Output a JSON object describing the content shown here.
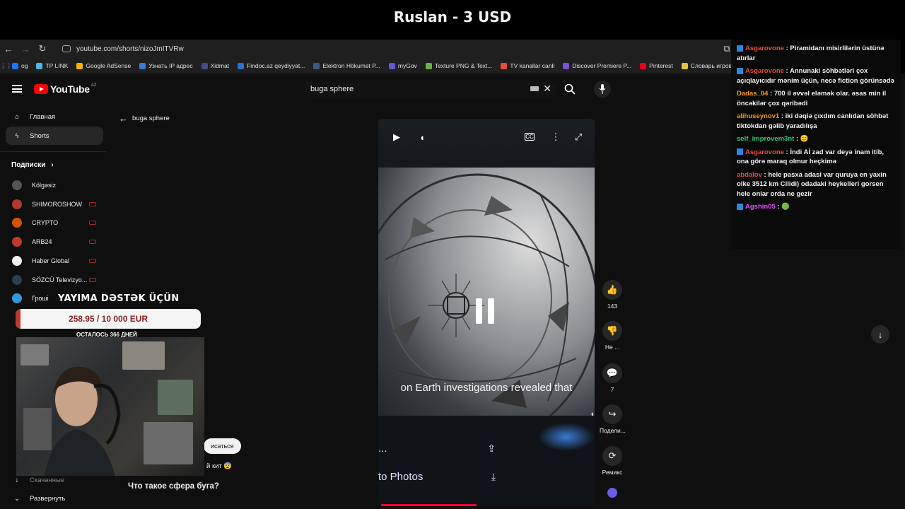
{
  "stream": {
    "title": "Ruslan - 3 USD"
  },
  "browser": {
    "url": "youtube.com/shorts/nizoJmITVRw",
    "bookmarks": [
      {
        "label": "og",
        "color": "#1877f2"
      },
      {
        "label": "TP LINK",
        "color": "#4ab8e8"
      },
      {
        "label": "Google AdSense",
        "color": "#f4b400"
      },
      {
        "label": "Узнать IP адрес",
        "color": "#3a7bd5"
      },
      {
        "label": "Xidmat",
        "color": "#444a8c"
      },
      {
        "label": "Findoc.az qeydiyyat...",
        "color": "#2a6fdb"
      },
      {
        "label": "Elektron Hökumət P...",
        "color": "#3d5a80"
      },
      {
        "label": "myGov",
        "color": "#5b5bd6"
      },
      {
        "label": "Texture PNG & Text...",
        "color": "#6ab04c"
      },
      {
        "label": "TV kanallar canli",
        "color": "#e74c3c"
      },
      {
        "label": "Discover Premiere P...",
        "color": "#7b4fd6"
      },
      {
        "label": "Pinterest",
        "color": "#e60023"
      },
      {
        "label": "Словарь игровых т...",
        "color": "#e1c340"
      }
    ]
  },
  "youtube": {
    "logo": "YouTube",
    "region": "AZ",
    "search": {
      "value": "buga sphere"
    },
    "back_label": "buga sphere",
    "nav": [
      {
        "label": "Главная",
        "icon": "home-icon"
      },
      {
        "label": "Shorts",
        "icon": "shorts-icon"
      }
    ],
    "subscriptions_label": "Подписки",
    "channels": [
      {
        "name": "Kölgəsiz",
        "color": "#555"
      },
      {
        "name": "SHIMOROSHOW",
        "color": "#b03a2e"
      },
      {
        "name": "CRYPTO",
        "color": "#d35400"
      },
      {
        "name": "ARB24",
        "color": "#c0392b"
      },
      {
        "name": "Haber Global",
        "color": "#ecf0f1"
      },
      {
        "name": "SÖZCÜ Televizyo...",
        "color": "#2c3e50"
      },
      {
        "name": "Гроші",
        "color": "#3498db"
      }
    ],
    "bottom_nav": [
      {
        "label": "Скачанные"
      },
      {
        "label": "Развернуть"
      }
    ],
    "subscribe_pill": "исаться",
    "comment_fragment": "й кит 😨",
    "short_title": "Что такое сфера буга?"
  },
  "video": {
    "subtitle": "on Earth investigations revealed that",
    "menu_items": [
      {
        "label": "...",
        "icon": "share-icon"
      },
      {
        "label": "to Photos",
        "icon": "download-icon"
      }
    ]
  },
  "actions": [
    {
      "name": "like",
      "label": "143",
      "glyph": "👍"
    },
    {
      "name": "dislike",
      "label": "Не ...",
      "glyph": "👎"
    },
    {
      "name": "comments",
      "label": "7",
      "glyph": "💬"
    },
    {
      "name": "share",
      "label": "Подели...",
      "glyph": "↪"
    },
    {
      "name": "remix",
      "label": "Ремикс",
      "glyph": "⟳"
    }
  ],
  "chat": [
    {
      "user": "Asgarovone",
      "color": "#e74c3c",
      "text": "Piramidanı misirlilərin üstünə atırlar",
      "twitch": true
    },
    {
      "user": "Asgarovone",
      "color": "#e74c3c",
      "text": "Annunaki söhbətləri çox açıqlayıcıdır mənim üçün, necə fiction görünsədə",
      "twitch": true
    },
    {
      "user": "Dadas_04",
      "color": "#f39c12",
      "text": "700 il əvvəl eləmək olar. əsas min il öncəkilər çox qəribədi",
      "twitch": false
    },
    {
      "user": "alihuseynov1",
      "color": "#f39c12",
      "text": "iki dəqiə çıxdım canlıdan söhbət tiktokdan gəlib yaradılışa",
      "twitch": false
    },
    {
      "user": "self_improvem3nt",
      "color": "#2ecc71",
      "text": "😊",
      "twitch": false
    },
    {
      "user": "Asgarovone",
      "color": "#e74c3c",
      "text": "İndi Aİ zad var deyə inam itib, ona görə maraq olmur heçkimə",
      "twitch": true
    },
    {
      "user": "abdalov",
      "color": "#e74c3c",
      "text": "hele pasxa adasi var quruya en yaxin olke 3512 km Cilidi) odadaki heykelleri gorsen hele onlar orda ne gezir",
      "twitch": false
    },
    {
      "user": "Agshin05",
      "color": "#e056fd",
      "text": "🟢",
      "twitch": true
    }
  ],
  "donation": {
    "title": "YAYIMA DƏSTƏK ÜÇÜN",
    "amount": "258.95 / 10 000 EUR",
    "progress": 0.026,
    "days_left": "ОСТАЛОСЬ 366 ДНЕЙ"
  }
}
